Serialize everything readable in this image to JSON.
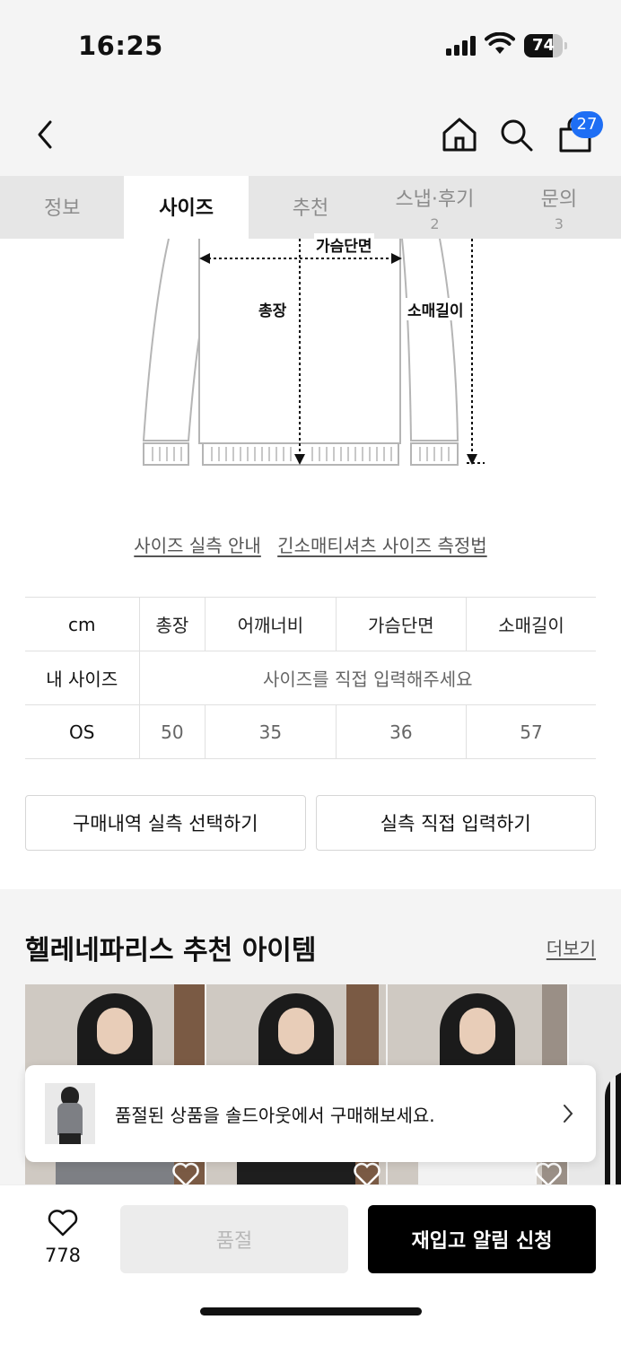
{
  "status_bar": {
    "time": "16:25",
    "battery": "74",
    "battery_level": 0.74
  },
  "header": {
    "cart_count": "27",
    "icons": [
      "back-icon",
      "home-icon",
      "search-icon",
      "cart-icon"
    ]
  },
  "tabs": [
    {
      "label": "정보",
      "count": ""
    },
    {
      "label": "사이즈",
      "count": ""
    },
    {
      "label": "추천",
      "count": ""
    },
    {
      "label": "스냅·후기",
      "count": "2"
    },
    {
      "label": "문의",
      "count": "3"
    }
  ],
  "diagram": {
    "labels": {
      "chest": "가슴단면",
      "length": "총장",
      "sleeve": "소매길이"
    }
  },
  "links": {
    "guide": "사이즈 실측 안내",
    "measure": "긴소매티셔츠 사이즈 측정법"
  },
  "size_table": {
    "unit": "cm",
    "headers": [
      "총장",
      "어깨너비",
      "가슴단면",
      "소매길이"
    ],
    "my_size_label": "내 사이즈",
    "my_size_prompt": "사이즈를 직접 입력해주세요",
    "rows": [
      {
        "size": "OS",
        "values": [
          "50",
          "35",
          "36",
          "57"
        ]
      }
    ]
  },
  "actions": {
    "select_purchase": "구매내역 실측 선택하기",
    "direct_input": "실측 직접 입력하기"
  },
  "recommend": {
    "title": "헬레네파리스 추천 아이템",
    "more": "더보기"
  },
  "toast": {
    "text": "품절된 상품을 솔드아웃에서 구매해보세요."
  },
  "bottom_bar": {
    "likes": "778",
    "soldout": "품절",
    "restock": "재입고 알림 신청"
  },
  "colors": {
    "badge": "#1e6ef4",
    "primary_button": "#000000",
    "disabled_button": "#ececec"
  }
}
